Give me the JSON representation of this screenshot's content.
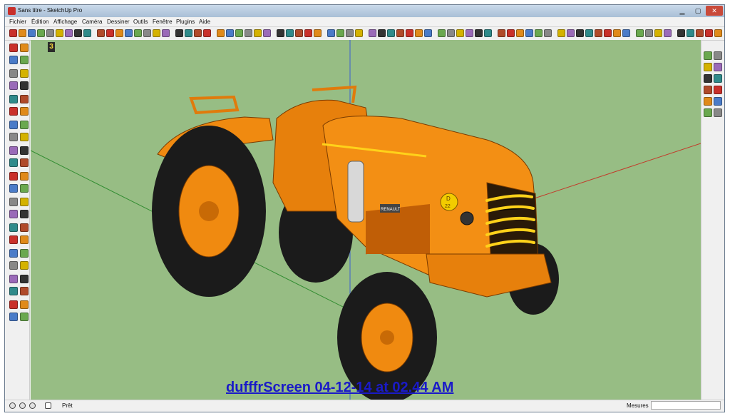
{
  "window": {
    "title": "Sans titre - SketchUp Pro",
    "controls": {
      "minimize": "▁",
      "maximize": "▢",
      "close": "✕"
    }
  },
  "menu": [
    "Fichier",
    "Édition",
    "Affichage",
    "Caméra",
    "Dessiner",
    "Outils",
    "Fenêtre",
    "Plugins",
    "Aide"
  ],
  "scene": {
    "tab_label": "3",
    "sky_ground_color": "#97bd84",
    "model": "orange tractor",
    "overlay_text": "dufffrScreen 04-12-14 at 02.44 AM"
  },
  "tractor": {
    "badge_letter": "D",
    "badge_number": "22",
    "plate_text": "RENAULT"
  },
  "colors": {
    "accent_orange": "#f08a10",
    "tire_black": "#1b1b1b",
    "axis_blue": "#3b5fcf",
    "axis_green": "#2d8a2d",
    "axis_red": "#c23a2a",
    "overlay_link": "#1a1ac8"
  },
  "statusbar": {
    "status": "Prêt",
    "measure_label": "Mesures",
    "measure_value": ""
  }
}
